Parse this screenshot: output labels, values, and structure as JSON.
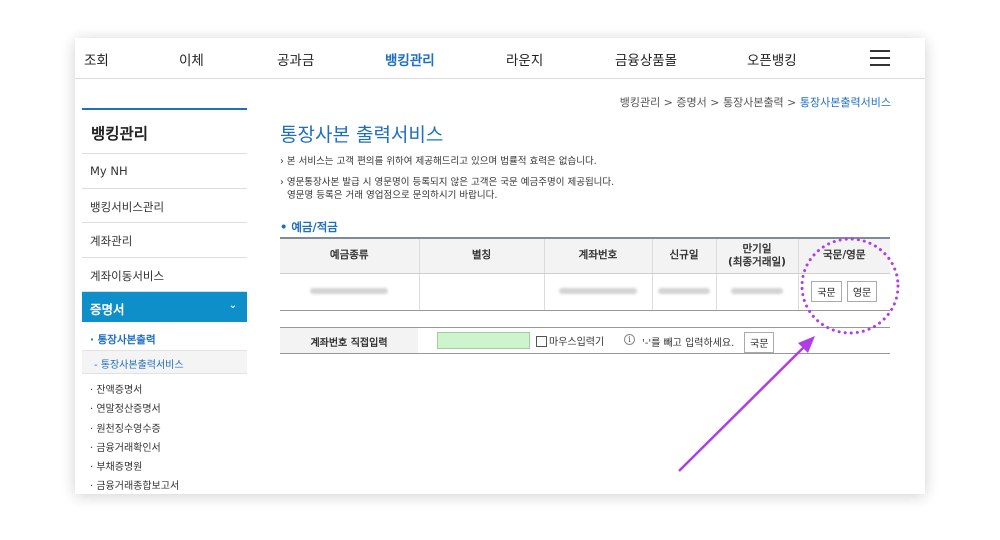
{
  "nav": {
    "items": [
      "조회",
      "이체",
      "공과금",
      "뱅킹관리",
      "라운지",
      "금융상품몰",
      "오픈뱅킹"
    ],
    "active_index": 3,
    "menu_icon": "hamburger-menu-icon"
  },
  "sidebar": {
    "title": "뱅킹관리",
    "items": [
      "My NH",
      "뱅킹서비스관리",
      "계좌관리",
      "계좌이동서비스"
    ],
    "active": {
      "label": "증명서",
      "chevron_icon": "chevron-down-icon"
    },
    "sub_item": "· 통장사본출력",
    "sub_sub_item": "- 통장사본출력서비스",
    "list": [
      "· 잔액증명서",
      "· 연말정산증명서",
      "· 원천징수영수증",
      "· 금융거래확인서",
      "· 부채증명원",
      "· 금융거래종합보고서"
    ]
  },
  "breadcrumb": {
    "path": "뱅킹관리 > 증명서 > 통장사본출력 > ",
    "current": "통장사본출력서비스"
  },
  "page": {
    "title": "통장사본 출력서비스",
    "notes": [
      [
        "본 서비스는 고객 편의를 위하여 제공해드리고 있으며 법률적 효력은 없습니다."
      ],
      [
        "영문통장사본 발급 시 영문명이 등록되지 않은 고객은 국문 예금주명이 제공됩니다.",
        "영문명 등록은 거래 영업점으로 문의하시기 바랍니다."
      ]
    ],
    "section_title": "• 예금/적금"
  },
  "table": {
    "headers": [
      "예금종류",
      "별칭",
      "계좌번호",
      "신규일",
      "만기일\n(최종거래일)",
      "국문/영문"
    ],
    "row": {
      "buttons": [
        "국문",
        "영문"
      ]
    }
  },
  "direct_input": {
    "label": "계좌번호 직접입력",
    "value": "",
    "mouse_input_label": "마우스입력기",
    "info_icon": "i",
    "hint": "'-'를 빼고 입력하세요.",
    "button": "국문"
  },
  "colors": {
    "accent": "#1e6fc2",
    "sidebar_active": "#0f8fc9",
    "annotation": "#b23de6"
  }
}
